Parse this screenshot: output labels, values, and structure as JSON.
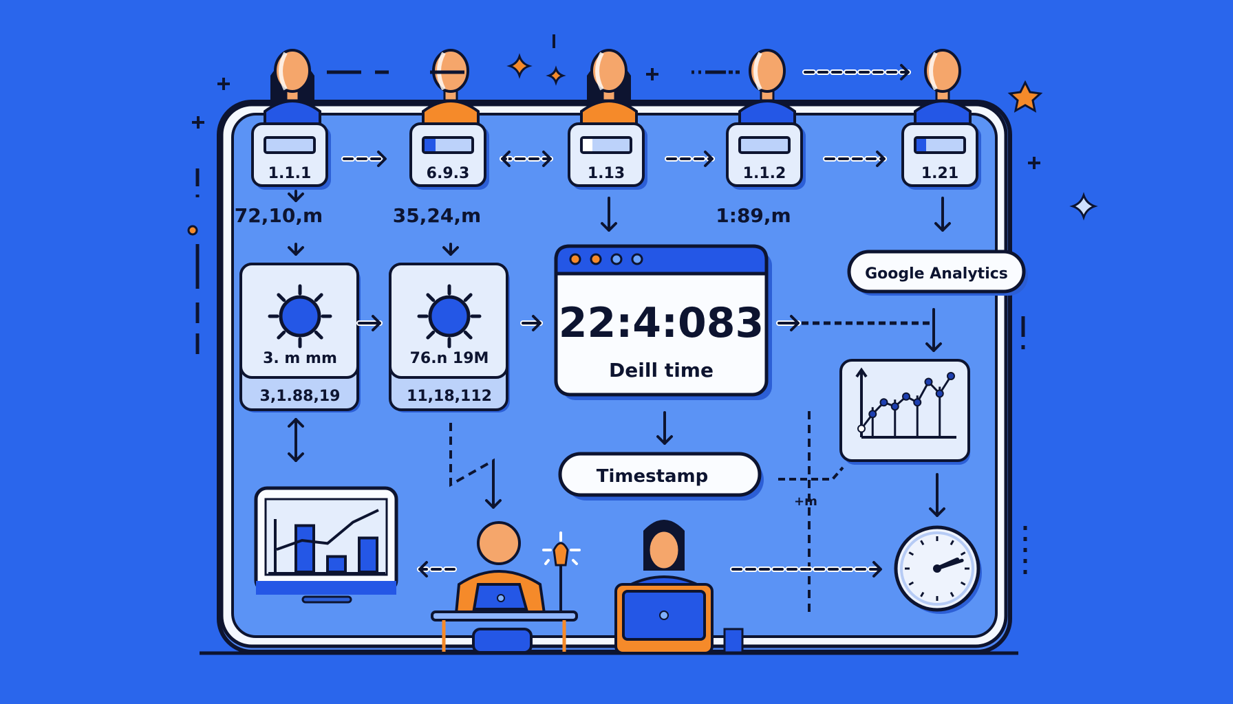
{
  "palette": {
    "background": "#2a66ec",
    "panel": "#5b93f5",
    "card": "#e4edfc",
    "ink": "#0d1430",
    "orange": "#f58a2a",
    "skin": "#f5a66b",
    "blue": "#2457e6"
  },
  "users": [
    {
      "version": "1.1.1",
      "metric": "72,10,m",
      "shirt": "blue",
      "hair": true
    },
    {
      "version": "6.9.3",
      "metric": "35,24,m",
      "shirt": "orange",
      "hair": false
    },
    {
      "version": "1.13",
      "metric": "",
      "shirt": "orange",
      "hair": true
    },
    {
      "version": "1.1.2",
      "metric": "1:89,m",
      "shirt": "blue",
      "hair": false
    },
    {
      "version": "1.21",
      "metric": "",
      "shirt": "blue",
      "hair": false
    }
  ],
  "gauges": [
    {
      "label": "3. m mm",
      "value": "3,1.88,19"
    },
    {
      "label": "76.n 19M",
      "value": "11,18,112"
    }
  ],
  "timer": {
    "value": "22:4:083",
    "caption": "Deill time"
  },
  "timestamp_label": "Timestamp",
  "analytics_label": "Google Analytics",
  "side_note": "+m",
  "trend_chart": {
    "points": [
      0.1,
      0.35,
      0.55,
      0.48,
      0.65,
      0.55,
      0.9,
      0.7,
      1.0
    ]
  },
  "monitor_chart": {
    "bars": [
      0.75,
      0.25,
      0.55
    ],
    "line": [
      0.35,
      0.5,
      0.45,
      0.8,
      1.0
    ]
  },
  "clock": {
    "hour": 2,
    "minute": 12
  }
}
